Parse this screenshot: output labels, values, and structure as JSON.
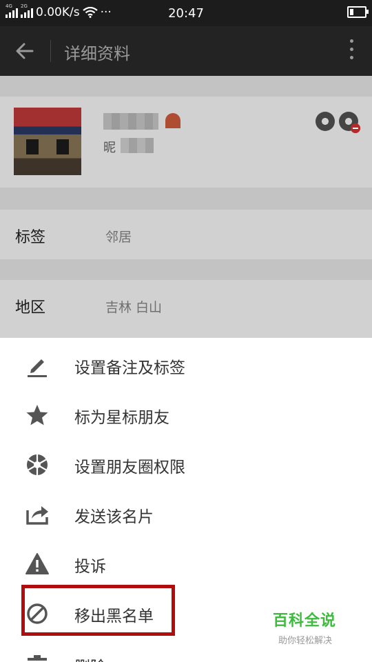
{
  "status_bar": {
    "network_tag_1": "4G",
    "network_tag_2": "2G",
    "speed": "0.00K/s",
    "dots": "···",
    "time": "20:47"
  },
  "title_bar": {
    "title": "详细资料"
  },
  "profile": {
    "nickname_prefix": "昵"
  },
  "rows": [
    {
      "label": "标签",
      "value": "邻居"
    },
    {
      "label": "地区",
      "value": "吉林  白山"
    }
  ],
  "menu": {
    "items": [
      {
        "label": "设置备注及标签",
        "icon": "pencil-icon"
      },
      {
        "label": "标为星标朋友",
        "icon": "star-icon"
      },
      {
        "label": "设置朋友圈权限",
        "icon": "aperture-icon"
      },
      {
        "label": "发送该名片",
        "icon": "share-icon"
      },
      {
        "label": "投诉",
        "icon": "warning-icon"
      },
      {
        "label": "移出黑名单",
        "icon": "block-icon"
      },
      {
        "label": "删除",
        "icon": "trash-icon"
      }
    ]
  },
  "watermark": {
    "title": "百科全说",
    "subtitle": "助你轻松解决"
  },
  "colors": {
    "highlight": "#b00e0e",
    "watermark_green": "#3dbb3d"
  }
}
